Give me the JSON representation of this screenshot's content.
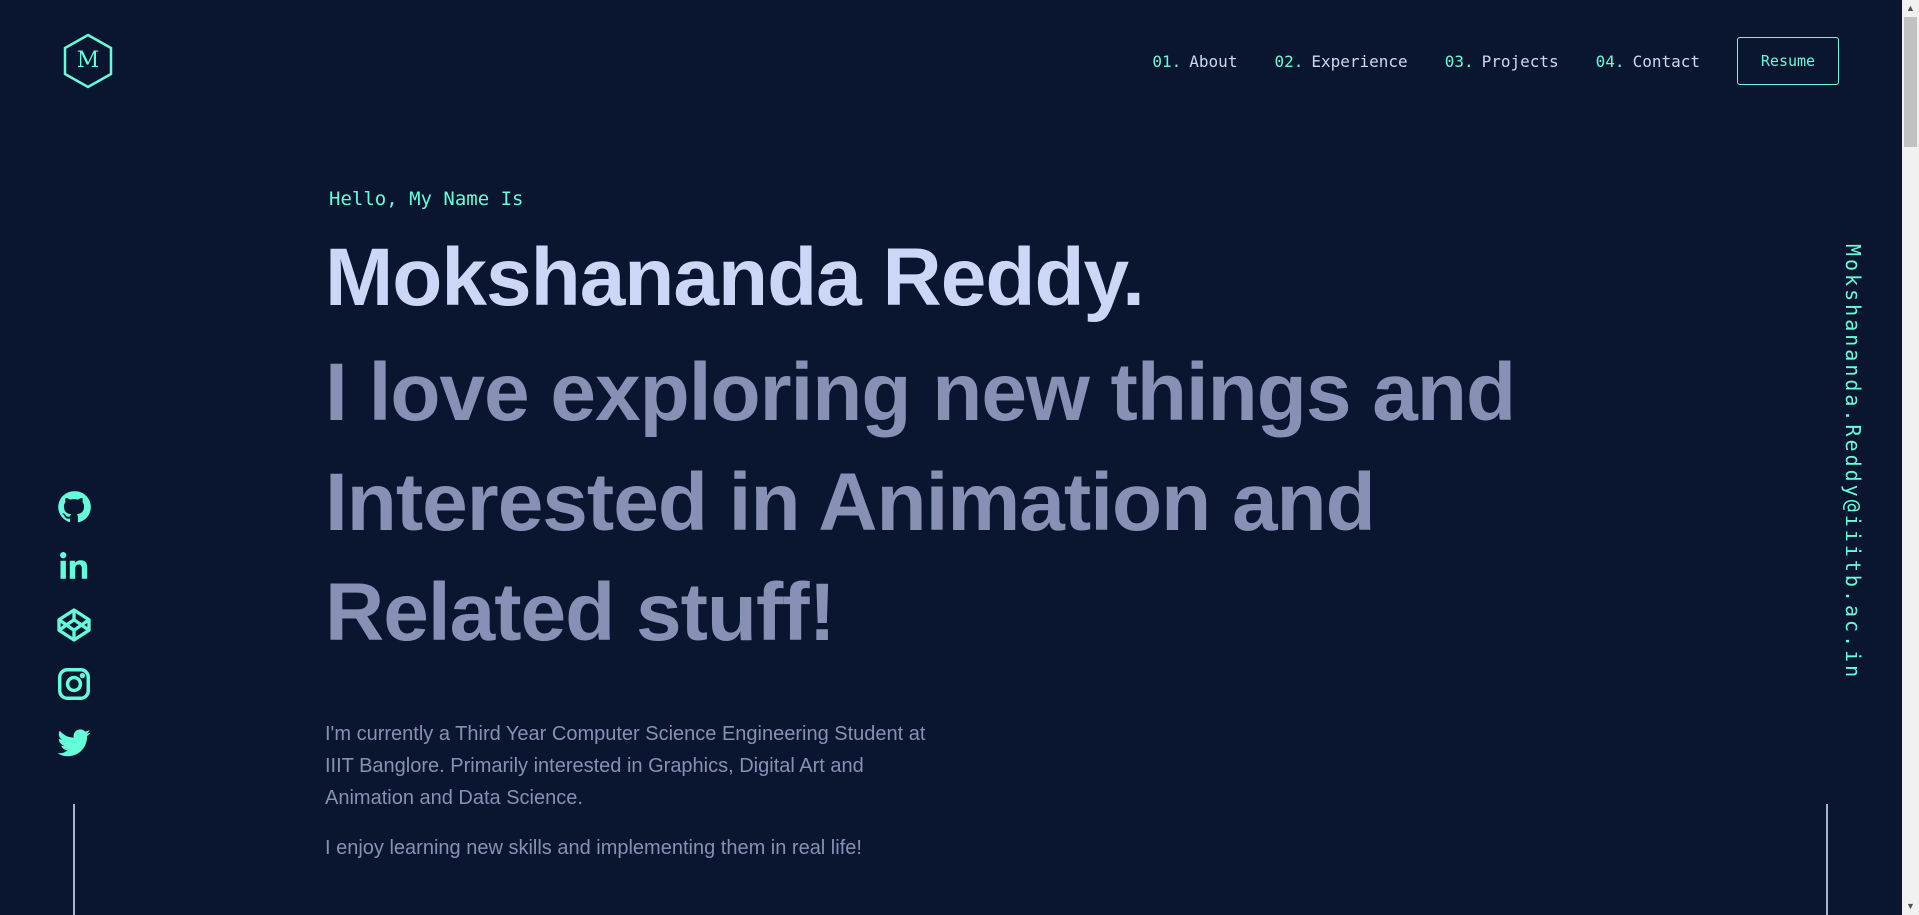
{
  "logo": {
    "letter": "M",
    "icon": "hexagon-logo-icon"
  },
  "nav": {
    "items": [
      {
        "num": "01.",
        "label": "About"
      },
      {
        "num": "02.",
        "label": "Experience"
      },
      {
        "num": "03.",
        "label": "Projects"
      },
      {
        "num": "04.",
        "label": "Contact"
      }
    ],
    "resume_label": "Resume"
  },
  "hero": {
    "greeting": "Hello, My Name Is",
    "name": "Mokshananda Reddy.",
    "tagline_lines": [
      "I love exploring new things and",
      "Interested in Animation and",
      "Related stuff!"
    ],
    "bio": "I'm currently a Third Year Computer Science Engineering Student at IIIT Banglore. Primarily interested in Graphics, Digital Art and Animation and Data Science.",
    "bio2": "I enjoy learning new skills and implementing them in real life!"
  },
  "social": {
    "icons": [
      "github-icon",
      "linkedin-icon",
      "codepen-icon",
      "instagram-icon",
      "twitter-icon"
    ]
  },
  "email": "Mokshananda.Reddy@iiitb.ac.in",
  "colors": {
    "background": "#0a162f",
    "accent": "#64ffda",
    "heading": "#ccd6f6",
    "text": "#8890b5"
  }
}
